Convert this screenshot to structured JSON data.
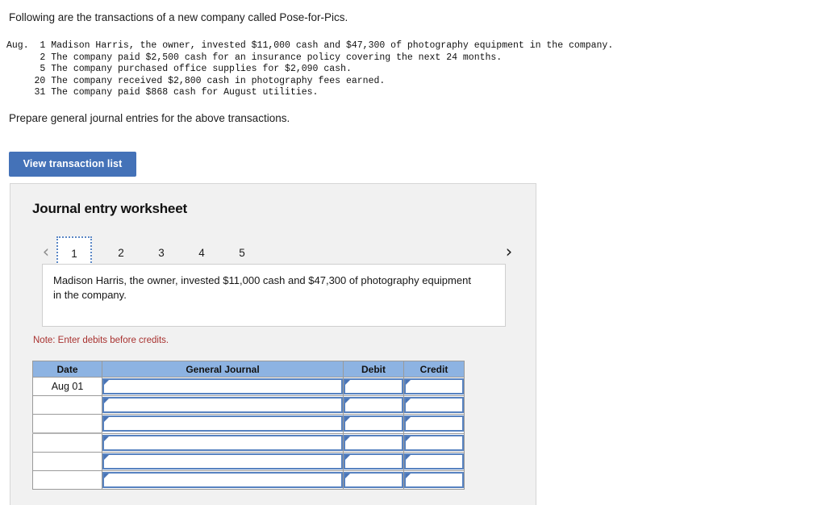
{
  "intro": {
    "line": "Following are the transactions of a new company called Pose-for-Pics."
  },
  "transactions": {
    "month_label": "Aug.",
    "lines": [
      {
        "day": "1",
        "text": "Madison Harris, the owner, invested $11,000 cash and $47,300 of photography equipment in the company."
      },
      {
        "day": "2",
        "text": "The company paid $2,500 cash for an insurance policy covering the next 24 months."
      },
      {
        "day": "5",
        "text": "The company purchased office supplies for $2,090 cash."
      },
      {
        "day": "20",
        "text": "The company received $2,800 cash in photography fees earned."
      },
      {
        "day": "31",
        "text": "The company paid $868 cash for August utilities."
      }
    ],
    "block": "Aug.  1 Madison Harris, the owner, invested $11,000 cash and $47,300 of photography equipment in the company.\n      2 The company paid $2,500 cash for an insurance policy covering the next 24 months.\n      5 The company purchased office supplies for $2,090 cash.\n     20 The company received $2,800 cash in photography fees earned.\n     31 The company paid $868 cash for August utilities."
  },
  "instruction": "Prepare general journal entries for the above transactions.",
  "buttons": {
    "view_transaction_list": "View transaction list"
  },
  "worksheet": {
    "title": "Journal entry worksheet",
    "prev_icon": "‹",
    "next_icon": "›",
    "tabs": [
      {
        "label": "1",
        "active": true
      },
      {
        "label": "2",
        "active": false
      },
      {
        "label": "3",
        "active": false
      },
      {
        "label": "4",
        "active": false
      },
      {
        "label": "5",
        "active": false
      }
    ],
    "description": "Madison Harris, the owner, invested $11,000 cash and $47,300 of photography equipment in the company.",
    "note": "Note: Enter debits before credits.",
    "table": {
      "headers": [
        "Date",
        "General Journal",
        "Debit",
        "Credit"
      ],
      "rows": [
        {
          "date": "Aug 01",
          "general_journal": "",
          "debit": "",
          "credit": ""
        },
        {
          "date": "",
          "general_journal": "",
          "debit": "",
          "credit": ""
        },
        {
          "date": "",
          "general_journal": "",
          "debit": "",
          "credit": ""
        },
        {
          "date": "",
          "general_journal": "",
          "debit": "",
          "credit": ""
        },
        {
          "date": "",
          "general_journal": "",
          "debit": "",
          "credit": ""
        },
        {
          "date": "",
          "general_journal": "",
          "debit": "",
          "credit": ""
        }
      ]
    }
  },
  "colors": {
    "button_blue": "#4472b8",
    "header_blue": "#8db3e2",
    "input_border_blue": "#5782c0",
    "note_red": "#a8312f",
    "panel_bg": "#f1f1f1"
  }
}
